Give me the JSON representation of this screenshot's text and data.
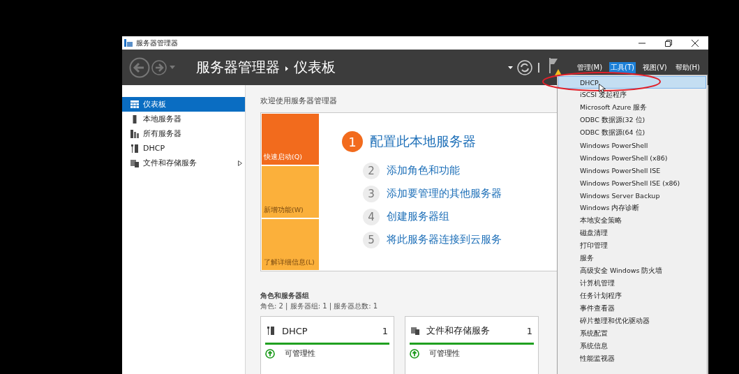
{
  "window": {
    "title": "服务器管理器"
  },
  "header": {
    "breadcrumb": [
      "服务器管理器",
      "仪表板"
    ],
    "menus": [
      {
        "label": "管理(M)",
        "selected": false
      },
      {
        "label": "工具(T)",
        "selected": true
      },
      {
        "label": "视图(V)",
        "selected": false
      },
      {
        "label": "帮助(H)",
        "selected": false
      }
    ]
  },
  "sidebar": {
    "items": [
      {
        "label": "仪表板",
        "kind": "dashboard",
        "selected": true,
        "expandable": false
      },
      {
        "label": "本地服务器",
        "kind": "server",
        "selected": false,
        "expandable": false
      },
      {
        "label": "所有服务器",
        "kind": "servers",
        "selected": false,
        "expandable": false
      },
      {
        "label": "DHCP",
        "kind": "dhcp",
        "selected": false,
        "expandable": false
      },
      {
        "label": "文件和存储服务",
        "kind": "storage",
        "selected": false,
        "expandable": true
      }
    ]
  },
  "welcome": {
    "title": "欢迎使用服务器管理器",
    "tiles": [
      {
        "label": "快速启动(Q)",
        "selected": true
      },
      {
        "label": "新增功能(W)",
        "selected": false
      },
      {
        "label": "了解详细信息(L)",
        "selected": false
      }
    ],
    "steps": [
      {
        "number": "1",
        "label": "配置此本地服务器",
        "selected": true
      },
      {
        "number": "2",
        "label": "添加角色和功能",
        "selected": false
      },
      {
        "number": "3",
        "label": "添加要管理的其他服务器",
        "selected": false
      },
      {
        "number": "4",
        "label": "创建服务器组",
        "selected": false
      },
      {
        "number": "5",
        "label": "将此服务器连接到云服务",
        "selected": false
      }
    ]
  },
  "roles": {
    "title": "角色和服务器组",
    "summary": "角色: 2 | 服务器组: 1 | 服务器总数: 1",
    "cards": [
      {
        "name": "DHCP",
        "kind": "dhcp",
        "count": "1",
        "status": "可管理性"
      },
      {
        "name": "文件和存储服务",
        "kind": "storage",
        "count": "1",
        "status": "可管理性"
      }
    ]
  },
  "tools_menu": {
    "items": [
      {
        "label": "DHCP",
        "selected": true
      },
      {
        "label": "iSCSI 发起程序",
        "selected": false
      },
      {
        "label": "Microsoft Azure 服务",
        "selected": false
      },
      {
        "label": "ODBC 数据源(32 位)",
        "selected": false
      },
      {
        "label": "ODBC 数据源(64 位)",
        "selected": false
      },
      {
        "label": "Windows PowerShell",
        "selected": false
      },
      {
        "label": "Windows PowerShell (x86)",
        "selected": false
      },
      {
        "label": "Windows PowerShell ISE",
        "selected": false
      },
      {
        "label": "Windows PowerShell ISE (x86)",
        "selected": false
      },
      {
        "label": "Windows Server Backup",
        "selected": false
      },
      {
        "label": "Windows 内存诊断",
        "selected": false
      },
      {
        "label": "本地安全策略",
        "selected": false
      },
      {
        "label": "磁盘清理",
        "selected": false
      },
      {
        "label": "打印管理",
        "selected": false
      },
      {
        "label": "服务",
        "selected": false
      },
      {
        "label": "高级安全 Windows 防火墙",
        "selected": false
      },
      {
        "label": "计算机管理",
        "selected": false
      },
      {
        "label": "任务计划程序",
        "selected": false
      },
      {
        "label": "事件查看器",
        "selected": false
      },
      {
        "label": "碎片整理和优化驱动器",
        "selected": false
      },
      {
        "label": "系统配置",
        "selected": false
      },
      {
        "label": "系统信息",
        "selected": false
      },
      {
        "label": "性能监视器",
        "selected": false
      }
    ]
  }
}
